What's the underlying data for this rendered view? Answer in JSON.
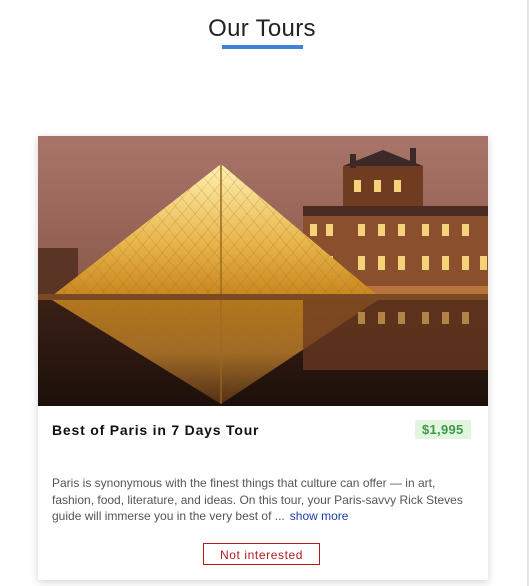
{
  "header": {
    "title": "Our Tours",
    "underline_color": "#3f80d8"
  },
  "tours": [
    {
      "name": "Best of Paris in 7 Days Tour",
      "price": "$1,995",
      "info": "Paris is synonymous with the finest things that culture can offer — in art, fashion, food, literature, and ideas. On this tour, your Paris-savvy Rick Steves guide will immerse you in the very best of ...",
      "show_more_label": "show more",
      "not_interested_label": "Not interested",
      "image_icon": "louvre-pyramid-photo",
      "price_color": "#3a9a48",
      "price_bg": "#e2f5de",
      "button_color": "#b31b1b"
    }
  ]
}
